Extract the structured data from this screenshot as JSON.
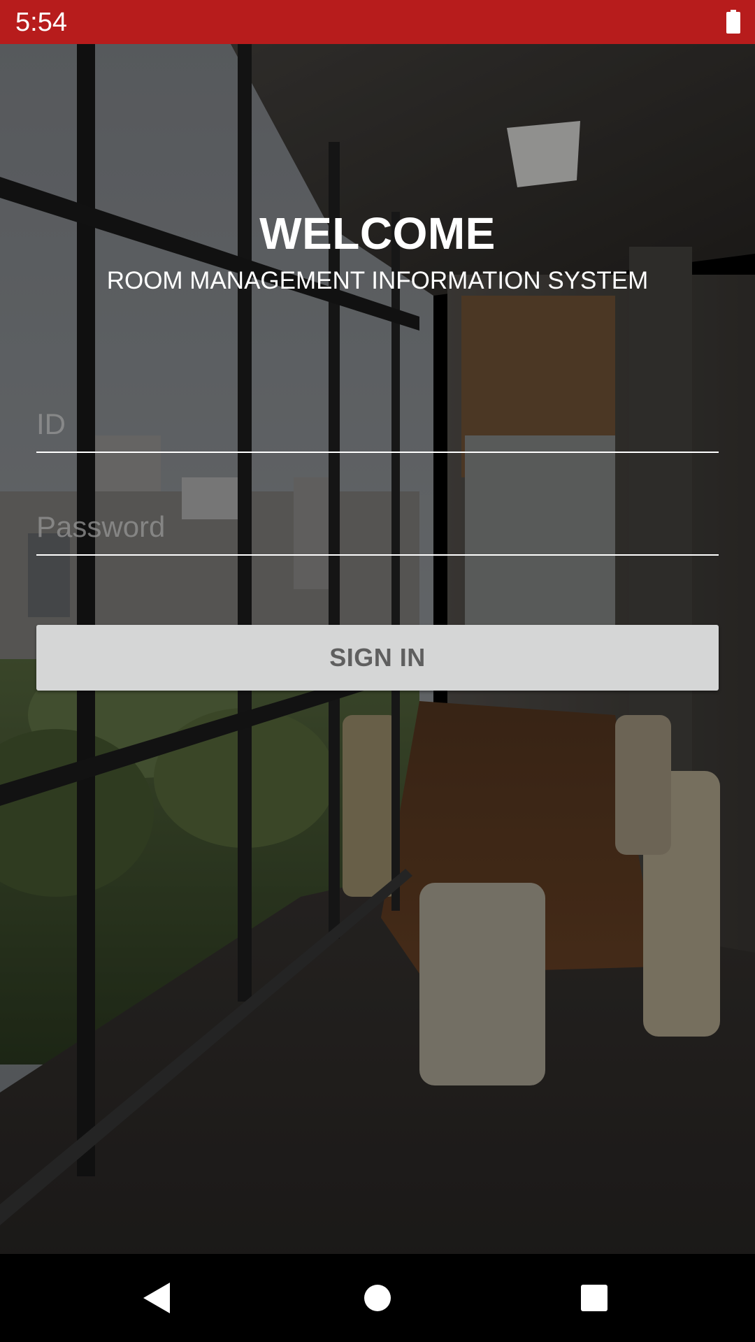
{
  "status_bar": {
    "time": "5:54",
    "icons": [
      "battery-icon"
    ],
    "color": "#b71c1c"
  },
  "login": {
    "title": "WELCOME",
    "subtitle": "ROOM MANAGEMENT INFORMATION SYSTEM",
    "id_field": {
      "placeholder": "ID",
      "value": ""
    },
    "password_field": {
      "placeholder": "Password",
      "value": ""
    },
    "sign_in_label": "SIGN IN",
    "button_color": "#d5d6d6"
  },
  "nav_bar": {
    "icons": [
      "back-icon",
      "home-icon",
      "recents-icon"
    ]
  }
}
